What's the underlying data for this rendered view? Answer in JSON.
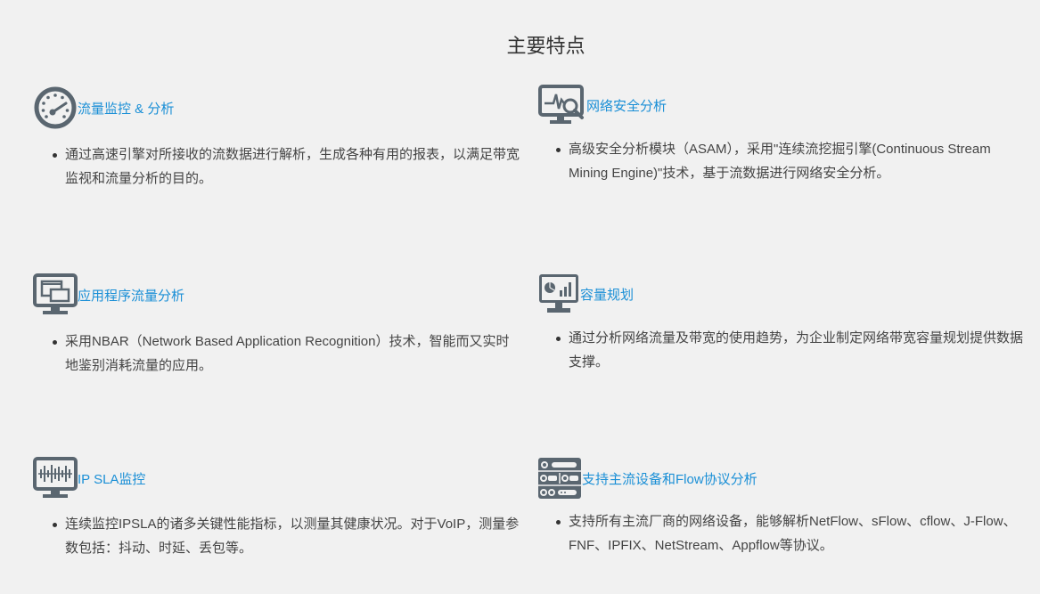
{
  "section": {
    "title": "主要特点"
  },
  "colors": {
    "accent": "#1a8fd6",
    "icon": "#5a6670",
    "text": "#444444",
    "background": "#f1f1f1"
  },
  "features": [
    {
      "icon": "speedometer-icon",
      "title": "流量监控 & 分析",
      "description": "通过高速引擎对所接收的流数据进行解析，生成各种有用的报表，以满足带宽监视和流量分析的目的。"
    },
    {
      "icon": "monitor-pulse-search-icon",
      "title": "网络安全分析",
      "description": "高级安全分析模块（ASAM），采用\"连续流挖掘引擎(Continuous Stream Mining Engine)\"技术，基于流数据进行网络安全分析。"
    },
    {
      "icon": "monitor-windows-icon",
      "title": "应用程序流量分析",
      "description": "采用NBAR（Network Based Application Recognition）技术，智能而又实时地鉴别消耗流量的应用。"
    },
    {
      "icon": "monitor-chart-icon",
      "title": "容量规划",
      "description": "通过分析网络流量及带宽的使用趋势，为企业制定网络带宽容量规划提供数据支撑。"
    },
    {
      "icon": "monitor-waveform-icon",
      "title": "IP SLA监控",
      "description": "连续监控IPSLA的诸多关键性能指标，以测量其健康状况。对于VoIP，测量参数包括：抖动、时延、丢包等。"
    },
    {
      "icon": "server-rack-icon",
      "title": "支持主流设备和Flow协议分析",
      "description": "支持所有主流厂商的网络设备，能够解析NetFlow、sFlow、cflow、J-Flow、FNF、IPFIX、NetStream、Appflow等协议。"
    }
  ]
}
